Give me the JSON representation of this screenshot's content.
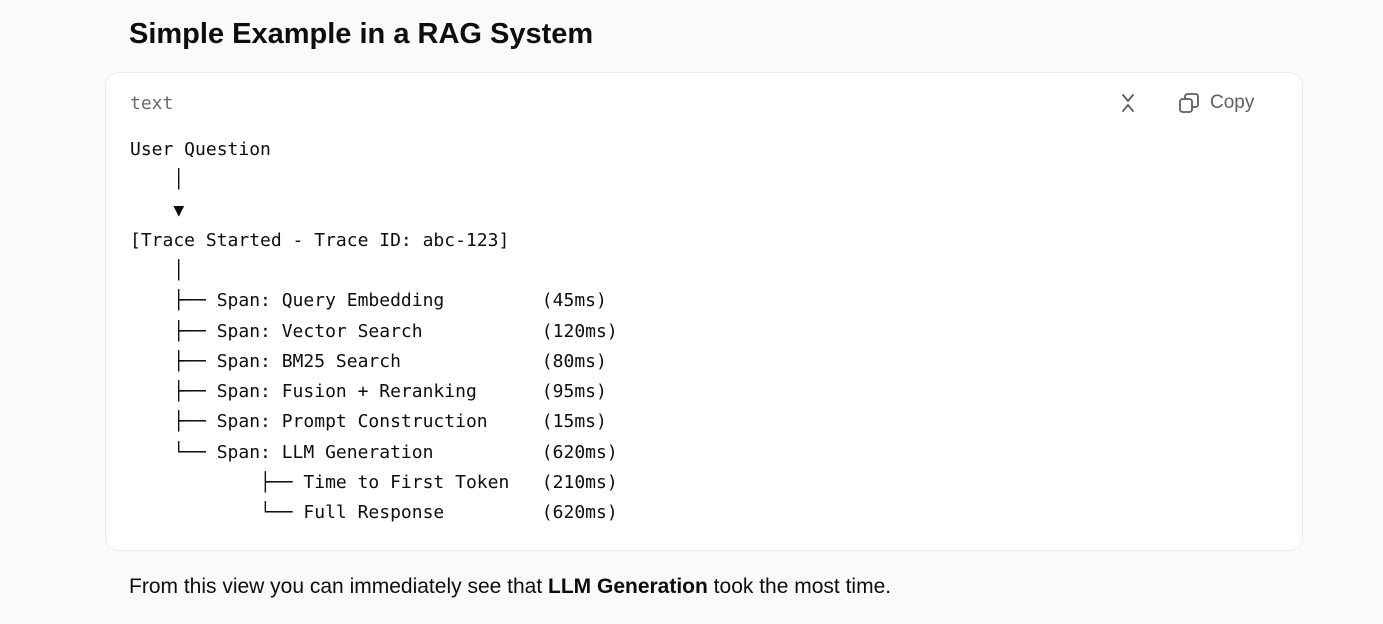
{
  "heading": "Simple Example in a RAG System",
  "code_block": {
    "language": "text",
    "collapse_icon": "collapse-chevrons-icon",
    "copy_icon": "copy-icon",
    "copy_label": "Copy",
    "lines": [
      "User Question",
      "    │",
      "    ▼",
      "[Trace Started - Trace ID: abc-123]",
      "    │",
      "    ├── Span: Query Embedding         (45ms)",
      "    ├── Span: Vector Search           (120ms)",
      "    ├── Span: BM25 Search             (80ms)",
      "    ├── Span: Fusion + Reranking      (95ms)",
      "    ├── Span: Prompt Construction     (15ms)",
      "    └── Span: LLM Generation          (620ms)",
      "            ├── Time to First Token   (210ms)",
      "            └── Full Response         (620ms)"
    ]
  },
  "summary": {
    "before": "From this view you can immediately see that ",
    "emphasis": "LLM Generation",
    "after": " took the most time."
  },
  "colors": {
    "page_background": "#fafafa",
    "card_background": "#ffffff",
    "card_border": "#ececec",
    "text": "#0d0d0d",
    "muted_text": "#6b6b6b"
  }
}
